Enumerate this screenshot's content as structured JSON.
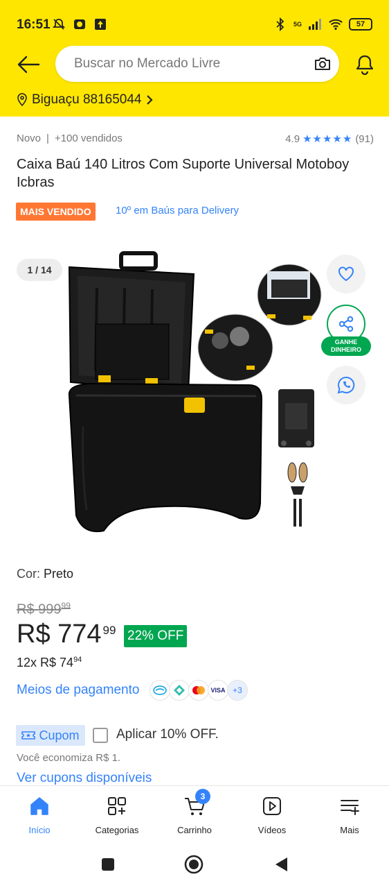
{
  "status_bar": {
    "time": "16:51",
    "network": "5G",
    "battery": "57"
  },
  "search": {
    "placeholder": "Buscar no Mercado Livre"
  },
  "location": {
    "text": "Biguaçu 88165044"
  },
  "product": {
    "condition": "Novo",
    "separator": "|",
    "sold": "+100 vendidos",
    "rating": "4.9",
    "stars": "★★★★★",
    "reviews": "(91)",
    "title": "Caixa Baú 140 Litros Com Suporte Universal Motoboy Icbras",
    "badge": "MAIS VENDIDO",
    "rank": "10º em Baús para Delivery"
  },
  "gallery": {
    "counter": "1 / 14",
    "earn_line1": "GANHE",
    "earn_line2": "DINHEIRO"
  },
  "variant": {
    "label": "Cor:",
    "value": "Preto"
  },
  "pricing": {
    "old_currency": "R$",
    "old_int": "999",
    "old_cents": "99",
    "currency": "R$",
    "price_int": "774",
    "price_cents": "99",
    "discount": "22% OFF",
    "installments_prefix": "12x R$ 74",
    "installments_cents": "94",
    "payment_link": "Meios de pagamento",
    "payment_more": "+3",
    "visa": "VISA"
  },
  "coupon": {
    "badge": "Cupom",
    "apply": "Aplicar 10% OFF.",
    "savings": "Você economiza R$ 1.",
    "see_all": "Ver cupons disponíveis"
  },
  "bottom_nav": {
    "items": [
      {
        "label": "Início"
      },
      {
        "label": "Categorias"
      },
      {
        "label": "Carrinho"
      },
      {
        "label": "Vídeos"
      },
      {
        "label": "Mais"
      }
    ],
    "cart_count": "3"
  },
  "colors": {
    "header": "#FFE600",
    "link": "#3483FA",
    "best_seller": "#FF7733",
    "discount": "#00A650"
  }
}
